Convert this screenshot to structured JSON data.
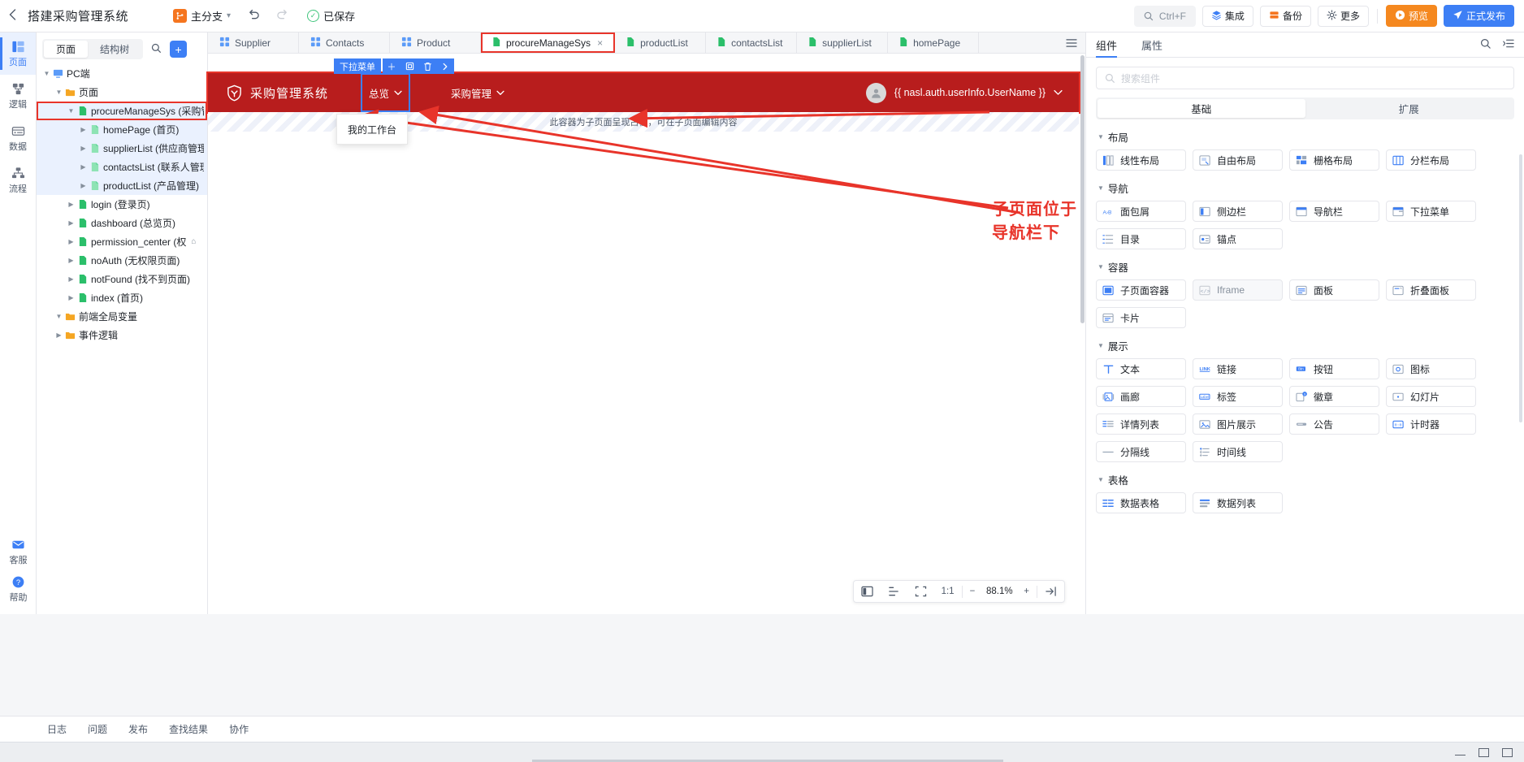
{
  "topbar": {
    "back_icon": "chevron-left-icon",
    "title": "搭建采购管理系统",
    "branch_icon": "branch-icon",
    "branch_label": "主分支",
    "undo_icon": "undo-icon",
    "redo_icon": "redo-icon",
    "saved_icon": "check-circle-icon",
    "saved_label": "已保存",
    "search_icon": "search-icon",
    "search_label": "Ctrl+F",
    "buttons": [
      {
        "label": "集成",
        "icon": "layers-icon"
      },
      {
        "label": "备份",
        "icon": "backup-icon"
      },
      {
        "label": "更多",
        "icon": "gear-icon"
      }
    ],
    "preview_label": "预览",
    "preview_icon": "play-icon",
    "publish_label": "正式发布",
    "publish_icon": "send-icon"
  },
  "rail": {
    "items": [
      {
        "label": "页面",
        "icon": "pages-icon",
        "active": true
      },
      {
        "label": "逻辑",
        "icon": "logic-icon",
        "active": false
      },
      {
        "label": "数据",
        "icon": "data-icon",
        "active": false
      },
      {
        "label": "流程",
        "icon": "flow-icon",
        "active": false
      }
    ],
    "bottom_items": [
      {
        "label": "客服",
        "icon": "support-icon"
      },
      {
        "label": "帮助",
        "icon": "help-icon"
      }
    ]
  },
  "tree": {
    "tabs": [
      {
        "label": "页面",
        "active": true
      },
      {
        "label": "结构树",
        "active": false
      }
    ],
    "search_icon": "search-icon",
    "add_icon": "plus-icon",
    "nodes": [
      {
        "label": "PC端",
        "depth": 0,
        "icon": "monitor-icon",
        "arrow": "down",
        "state": "normal"
      },
      {
        "label": "页面",
        "depth": 1,
        "icon": "folder-icon",
        "arrow": "down",
        "state": "normal"
      },
      {
        "label": "procureManageSys (采购管",
        "depth": 2,
        "icon": "page-icon",
        "arrow": "down",
        "state": "highlighted"
      },
      {
        "label": "homePage (首页)",
        "depth": 3,
        "icon": "subpage-icon",
        "arrow": "right",
        "state": "selected"
      },
      {
        "label": "supplierList (供应商管理)",
        "depth": 3,
        "icon": "subpage-icon",
        "arrow": "right",
        "state": "selected"
      },
      {
        "label": "contactsList (联系人管理)",
        "depth": 3,
        "icon": "subpage-icon",
        "arrow": "right",
        "state": "selected"
      },
      {
        "label": "productList (产品管理)",
        "depth": 3,
        "icon": "subpage-icon",
        "arrow": "right",
        "state": "selected"
      },
      {
        "label": "login (登录页)",
        "depth": 2,
        "icon": "page-icon",
        "arrow": "right",
        "state": "normal"
      },
      {
        "label": "dashboard (总览页)",
        "depth": 2,
        "icon": "page-icon",
        "arrow": "right",
        "state": "normal"
      },
      {
        "label": "permission_center (权",
        "depth": 2,
        "icon": "page-icon",
        "arrow": "right",
        "state": "normal",
        "home": true
      },
      {
        "label": "noAuth (无权限页面)",
        "depth": 2,
        "icon": "page-icon",
        "arrow": "right",
        "state": "normal"
      },
      {
        "label": "notFound (找不到页面)",
        "depth": 2,
        "icon": "page-icon",
        "arrow": "right",
        "state": "normal"
      },
      {
        "label": "index (首页)",
        "depth": 2,
        "icon": "page-icon",
        "arrow": "right",
        "state": "normal"
      },
      {
        "label": "前端全局变量",
        "depth": 1,
        "icon": "folder-icon",
        "arrow": "down",
        "state": "normal"
      },
      {
        "label": "事件逻辑",
        "depth": 1,
        "icon": "folder-icon",
        "arrow": "right",
        "state": "normal"
      }
    ]
  },
  "tabs": {
    "items": [
      {
        "label": "Supplier",
        "icon": "grid-icon",
        "active": false,
        "closable": false
      },
      {
        "label": "Contacts",
        "icon": "grid-icon",
        "active": false,
        "closable": false
      },
      {
        "label": "Product",
        "icon": "grid-icon",
        "active": false,
        "closable": false
      },
      {
        "label": "procureManageSys",
        "icon": "page-icon",
        "active": true,
        "closable": true
      },
      {
        "label": "productList",
        "icon": "page-icon",
        "active": false,
        "closable": false
      },
      {
        "label": "contactsList",
        "icon": "page-icon",
        "active": false,
        "closable": false
      },
      {
        "label": "supplierList",
        "icon": "page-icon",
        "active": false,
        "closable": false
      },
      {
        "label": "homePage",
        "icon": "page-icon",
        "active": false,
        "closable": false
      }
    ],
    "list_icon": "list-icon"
  },
  "widget_toolbar": {
    "name": "下拉菜单",
    "actions": [
      {
        "icon": "plus-icon"
      },
      {
        "icon": "copy-icon"
      },
      {
        "icon": "trash-icon"
      },
      {
        "icon": "chevron-right-icon"
      }
    ]
  },
  "navbar": {
    "logo_icon": "shield-icon",
    "title": "采购管理系统",
    "brand_color": "#b81d1d",
    "menus": [
      {
        "label": "总览",
        "selected": true,
        "caret": "chevron-down-icon"
      },
      {
        "label": "采购管理",
        "selected": false,
        "caret": "chevron-down-icon"
      }
    ],
    "avatar_icon": "user-icon",
    "username": "{{ nasl.auth.userInfo.UserName }}",
    "user_caret": "chevron-down-icon"
  },
  "dropdown_panel": {
    "items": [
      "我的工作台"
    ]
  },
  "slot": {
    "placeholder": "此容器为子页面呈现占位，可在子页面编辑内容"
  },
  "annotation": {
    "text": "子页面位于导航栏下",
    "color": "#e8342a"
  },
  "canvas_toolbar": {
    "panel_icon": "layout-panel-icon",
    "align_icon": "align-icon",
    "fit_icon": "fit-icon",
    "ratio_label": "1:1",
    "minus_label": "−",
    "zoom_label": "88.1%",
    "plus_label": "+",
    "collapse_icon": "collapse-right-icon"
  },
  "right_panel": {
    "tabs": [
      {
        "label": "组件",
        "active": true
      },
      {
        "label": "属性",
        "active": false
      }
    ],
    "actions": [
      {
        "icon": "search-icon"
      },
      {
        "icon": "expand-list-icon"
      }
    ],
    "search_placeholder": "搜索组件",
    "search_icon": "search-icon",
    "segments": [
      {
        "label": "基础",
        "active": true
      },
      {
        "label": "扩展",
        "active": false
      }
    ],
    "groups": [
      {
        "title": "布局",
        "items": [
          {
            "label": "线性布局",
            "icon": "linear-layout-icon",
            "disabled": false
          },
          {
            "label": "自由布局",
            "icon": "free-layout-icon",
            "disabled": false
          },
          {
            "label": "栅格布局",
            "icon": "grid-layout-icon",
            "disabled": false
          },
          {
            "label": "分栏布局",
            "icon": "column-layout-icon",
            "disabled": false
          }
        ]
      },
      {
        "title": "导航",
        "items": [
          {
            "label": "面包屑",
            "icon": "breadcrumb-icon",
            "disabled": false
          },
          {
            "label": "侧边栏",
            "icon": "sidebar-icon",
            "disabled": false
          },
          {
            "label": "导航栏",
            "icon": "navbar-icon",
            "disabled": false
          },
          {
            "label": "下拉菜单",
            "icon": "dropdown-menu-icon",
            "disabled": false
          },
          {
            "label": "目录",
            "icon": "toc-icon",
            "disabled": false
          },
          {
            "label": "锚点",
            "icon": "anchor-icon",
            "disabled": false
          }
        ]
      },
      {
        "title": "容器",
        "items": [
          {
            "label": "子页面容器",
            "icon": "subpage-container-icon",
            "disabled": false
          },
          {
            "label": "Iframe",
            "icon": "iframe-icon",
            "disabled": true
          },
          {
            "label": "面板",
            "icon": "panel-icon",
            "disabled": false
          },
          {
            "label": "折叠面板",
            "icon": "collapse-panel-icon",
            "disabled": false
          },
          {
            "label": "卡片",
            "icon": "card-icon",
            "disabled": false
          }
        ]
      },
      {
        "title": "展示",
        "items": [
          {
            "label": "文本",
            "icon": "text-icon",
            "disabled": false
          },
          {
            "label": "链接",
            "icon": "link-icon",
            "disabled": false
          },
          {
            "label": "按钮",
            "icon": "button-icon",
            "disabled": false
          },
          {
            "label": "图标",
            "icon": "icon-icon",
            "disabled": false
          },
          {
            "label": "画廊",
            "icon": "gallery-icon",
            "disabled": false
          },
          {
            "label": "标签",
            "icon": "label-icon",
            "disabled": false
          },
          {
            "label": "徽章",
            "icon": "badge-icon",
            "disabled": false
          },
          {
            "label": "幻灯片",
            "icon": "slideshow-icon",
            "disabled": false
          },
          {
            "label": "详情列表",
            "icon": "detail-list-icon",
            "disabled": false
          },
          {
            "label": "图片展示",
            "icon": "image-icon",
            "disabled": false
          },
          {
            "label": "公告",
            "icon": "announcement-icon",
            "disabled": false
          },
          {
            "label": "计时器",
            "icon": "timer-icon",
            "disabled": false
          },
          {
            "label": "分隔线",
            "icon": "divider-icon",
            "disabled": false
          },
          {
            "label": "时间线",
            "icon": "timeline-icon",
            "disabled": false
          }
        ]
      },
      {
        "title": "表格",
        "items": [
          {
            "label": "数据表格",
            "icon": "data-table-icon",
            "disabled": false
          },
          {
            "label": "数据列表",
            "icon": "data-list-icon",
            "disabled": false
          }
        ]
      }
    ]
  },
  "bottom_bar": {
    "items": [
      "日志",
      "问题",
      "发布",
      "查找结果",
      "协作"
    ]
  },
  "taskbar": {
    "minimize_icon": "minimize-icon",
    "maximize_icon": "maximize-icon",
    "close_icon": "close-icon"
  }
}
